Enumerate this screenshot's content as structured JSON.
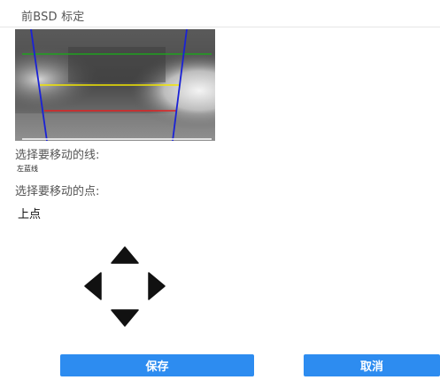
{
  "header": {
    "title": "前BSD 标定"
  },
  "camera_preview": {
    "overlay_line_colors": {
      "top_line": "#1fa11f",
      "middle_line": "#f2e600",
      "bottom_line": "#e02020",
      "side_lines": "#1a22d6",
      "base_line": "#ffffff"
    }
  },
  "controls": {
    "move_line_label": "选择要移动的线:",
    "move_line_value": "左蓝线",
    "move_point_label": "选择要移动的点:",
    "move_point_value": "上点"
  },
  "direction_pad": {
    "icons": [
      "arrow-up-icon",
      "arrow-left-icon",
      "arrow-right-icon",
      "arrow-down-icon"
    ]
  },
  "actions": {
    "save_label": "保存",
    "cancel_label": "取消",
    "button_color": "#2d8cf0"
  }
}
